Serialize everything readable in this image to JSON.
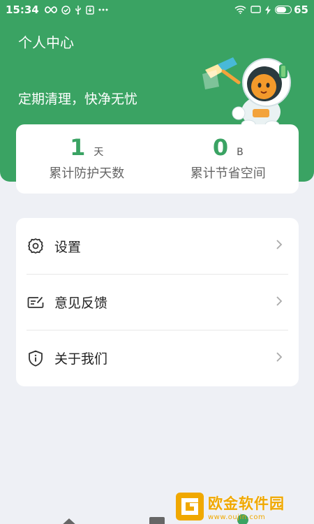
{
  "status_bar": {
    "time": "15:34",
    "battery_level": "65",
    "left_icons": [
      "infinity-icon",
      "check-circle-icon",
      "usb-icon",
      "download-icon",
      "more-dots-icon"
    ],
    "right_icons": [
      "wifi-icon",
      "screen-icon",
      "charging-icon",
      "battery-icon"
    ]
  },
  "header": {
    "title": "个人中心",
    "slogan": "定期清理，快净无忧"
  },
  "stats": [
    {
      "value": "1",
      "unit": "天",
      "label": "累计防护天数"
    },
    {
      "value": "0",
      "unit": "B",
      "label": "累计节省空间"
    }
  ],
  "menu": [
    {
      "label": "设置",
      "icon": "gear-icon"
    },
    {
      "label": "意见反馈",
      "icon": "feedback-icon"
    },
    {
      "label": "关于我们",
      "icon": "info-shield-icon"
    }
  ],
  "watermark": {
    "title": "欧金软件园",
    "url": "www.oujin.com"
  },
  "colors": {
    "brand_green": "#3aa363",
    "background": "#eef0f5",
    "watermark_orange": "#f0a800"
  }
}
